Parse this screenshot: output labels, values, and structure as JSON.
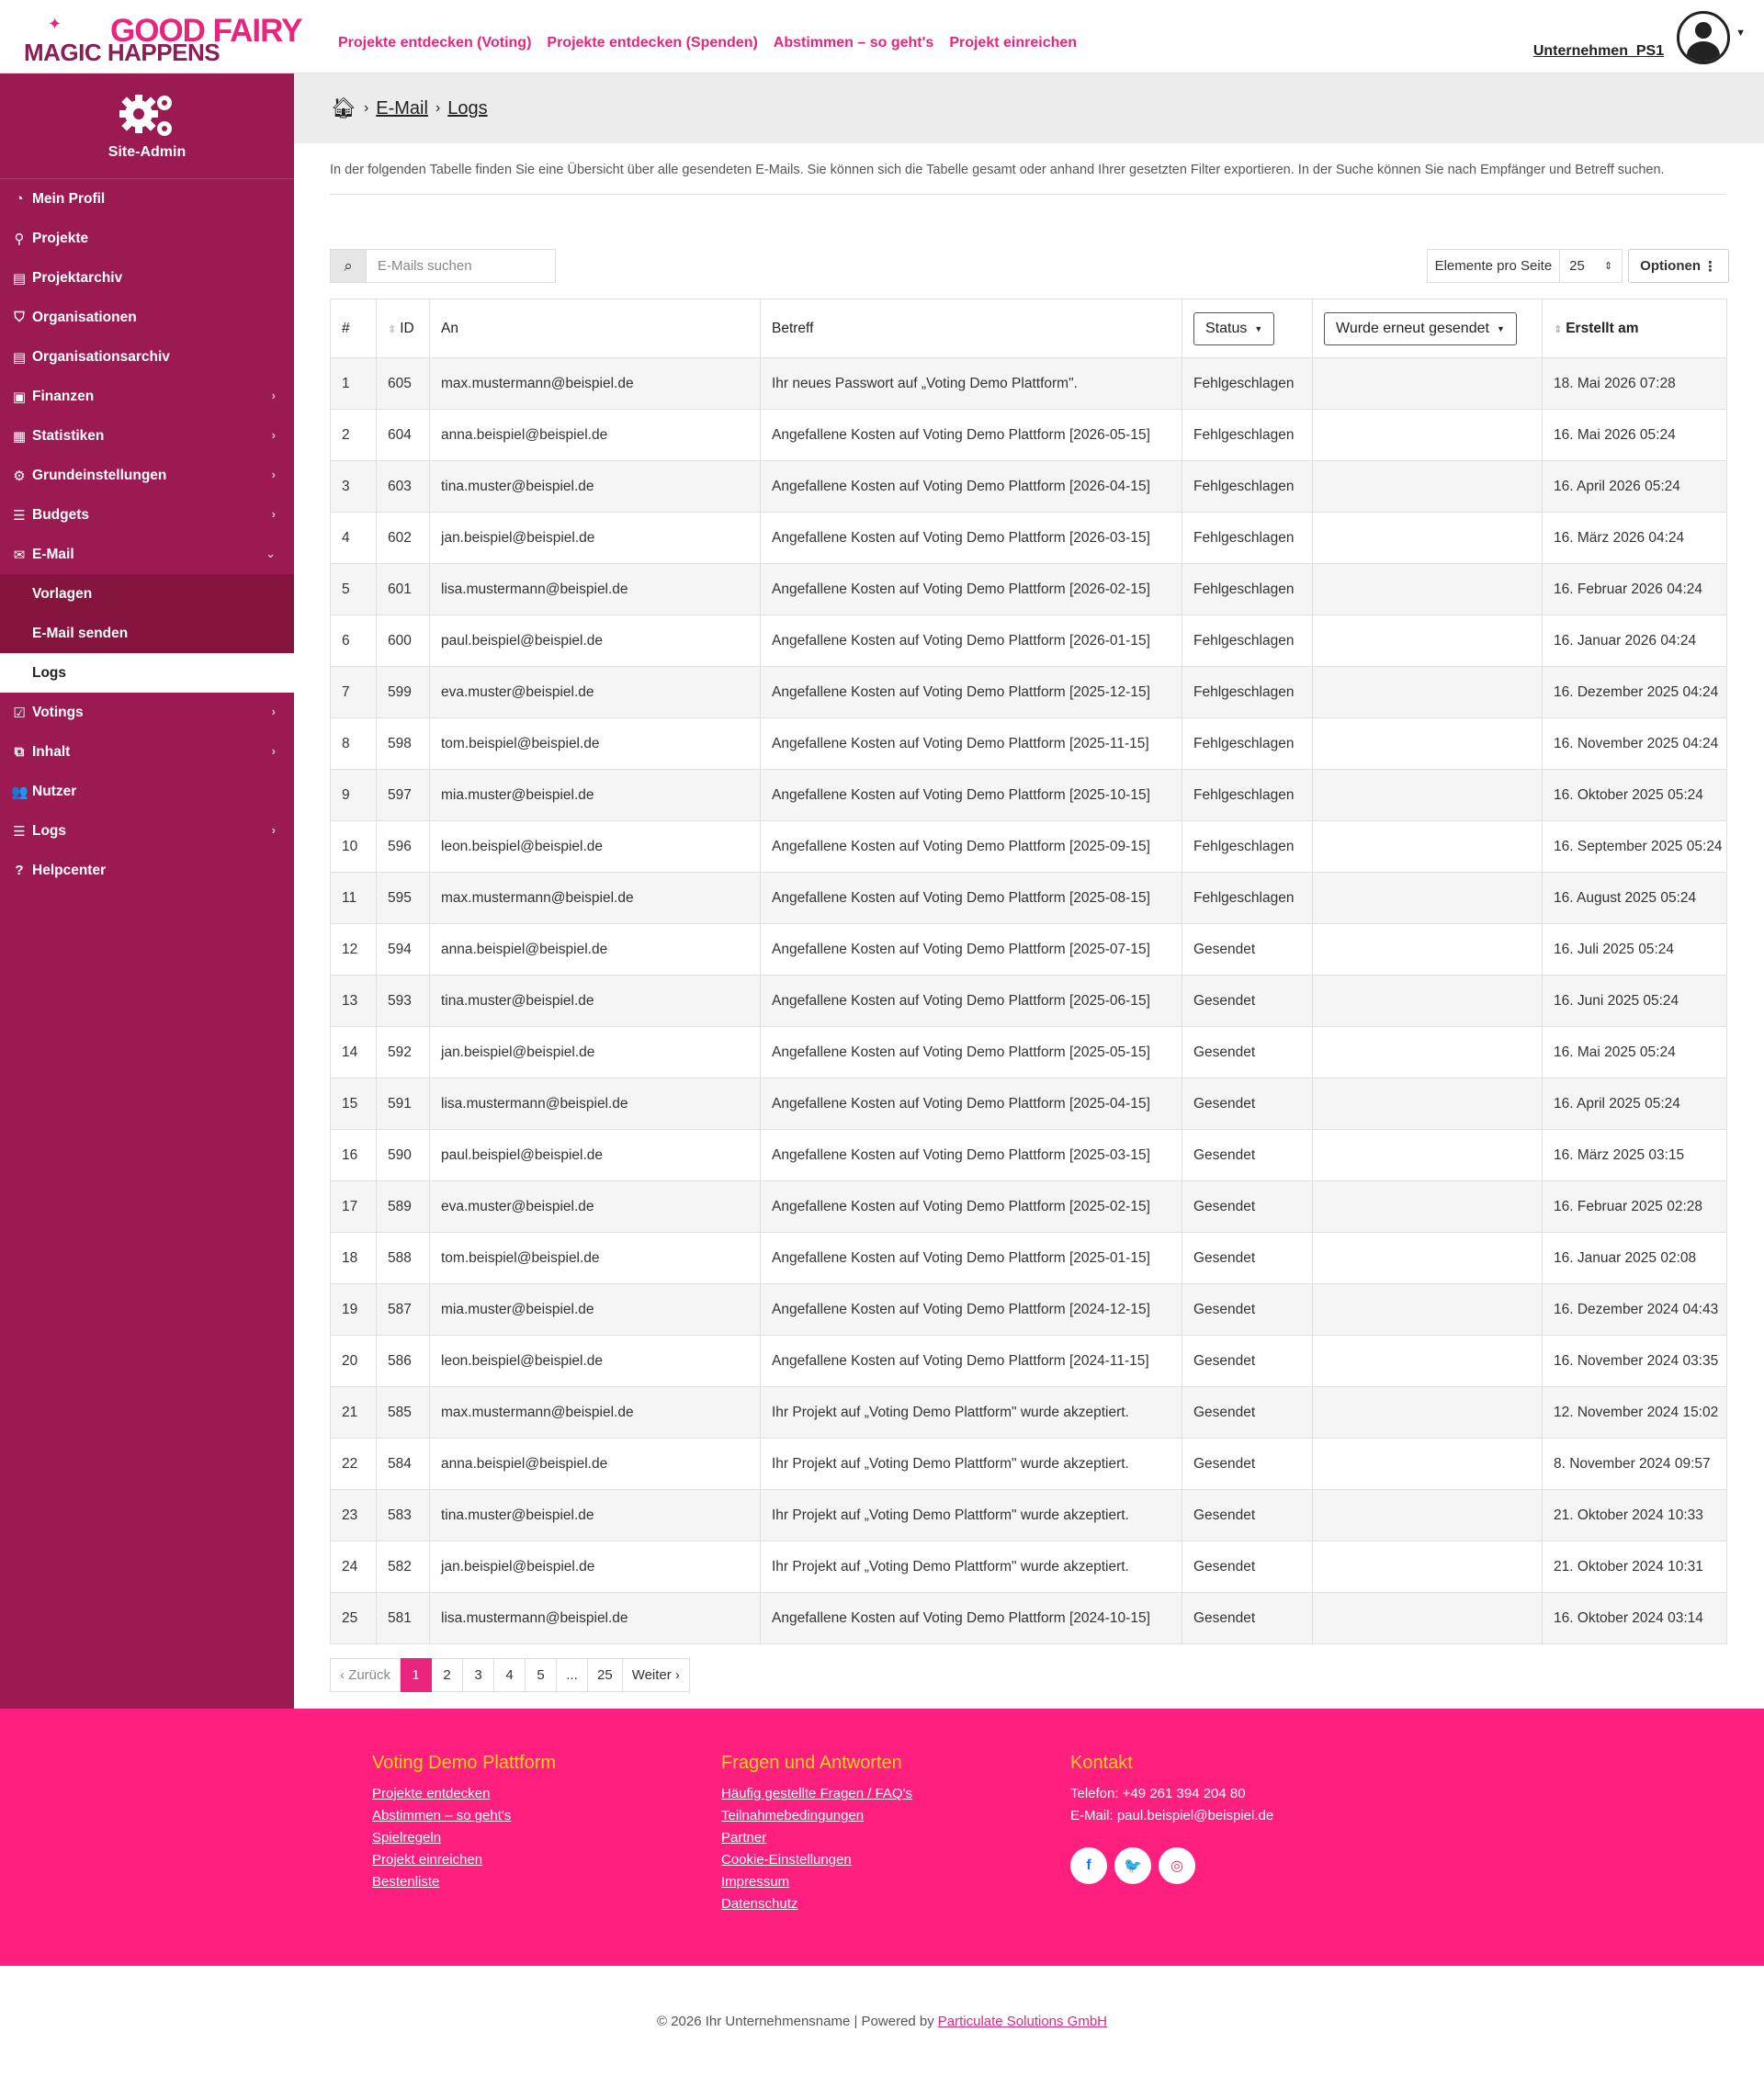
{
  "header": {
    "logo_top": "GOOD FAIRY",
    "logo_bottom": "MAGIC HAPPENS",
    "nav": [
      "Projekte entdecken (Voting)",
      "Projekte entdecken (Spenden)",
      "Abstimmen – so geht's",
      "Projekt einreichen"
    ],
    "username": "Unternehmen_PS1"
  },
  "sidebar": {
    "title": "Site-Admin",
    "items": [
      {
        "label": "Mein Profil",
        "icon": "dashboard-icon",
        "glyph": "◔"
      },
      {
        "label": "Projekte",
        "icon": "map-marker-icon",
        "glyph": "⚲"
      },
      {
        "label": "Projektarchiv",
        "icon": "archive-icon",
        "glyph": "▤"
      },
      {
        "label": "Organisationen",
        "icon": "shield-icon",
        "glyph": "⛉"
      },
      {
        "label": "Organisationsarchiv",
        "icon": "archive-icon",
        "glyph": "▤"
      },
      {
        "label": "Finanzen",
        "icon": "money-icon",
        "glyph": "▣"
      },
      {
        "label": "Statistiken",
        "icon": "bar-chart-icon",
        "glyph": "▦"
      },
      {
        "label": "Grundeinstellungen",
        "icon": "gears-icon",
        "glyph": "⚙"
      },
      {
        "label": "Budgets",
        "icon": "list-icon",
        "glyph": "☰"
      },
      {
        "label": "E-Mail",
        "icon": "envelope-icon",
        "glyph": "✉"
      }
    ],
    "email_sub": [
      "Vorlagen",
      "E-Mail senden",
      "Logs"
    ],
    "items_after": [
      {
        "label": "Votings",
        "icon": "checkbox-icon",
        "glyph": "☑"
      },
      {
        "label": "Inhalt",
        "icon": "sitemap-icon",
        "glyph": "⧉"
      },
      {
        "label": "Nutzer",
        "icon": "users-icon",
        "glyph": "👥"
      },
      {
        "label": "Logs",
        "icon": "list-icon",
        "glyph": "☰"
      },
      {
        "label": "Helpcenter",
        "icon": "question-circle-icon",
        "glyph": "?"
      }
    ]
  },
  "breadcrumb": {
    "level1": "E-Mail",
    "level2": "Logs"
  },
  "intro": "In der folgenden Tabelle finden Sie eine Übersicht über alle gesendeten E-Mails. Sie können sich die Tabelle gesamt oder anhand Ihrer gesetzten Filter exportieren. In der Suche können Sie nach Empfänger und Betreff suchen.",
  "search": {
    "placeholder": "E-Mails suchen"
  },
  "per_page": {
    "label": "Elemente pro Seite",
    "value": "25",
    "options_label": "Optionen"
  },
  "table": {
    "headers": {
      "num": "#",
      "id": "ID",
      "to": "An",
      "subject": "Betreff",
      "status": "Status",
      "resent": "Wurde erneut gesendet",
      "created": "Erstellt am"
    },
    "rows": [
      {
        "n": "1",
        "id": "605",
        "to": "max.mustermann@beispiel.de",
        "subject": "Ihr neues Passwort auf „Voting Demo Plattform\".",
        "status": "Fehlgeschlagen",
        "resent": "",
        "created": "18. Mai 2026 07:28"
      },
      {
        "n": "2",
        "id": "604",
        "to": "anna.beispiel@beispiel.de",
        "subject": "Angefallene Kosten auf Voting Demo Plattform [2026-05-15]",
        "status": "Fehlgeschlagen",
        "resent": "",
        "created": "16. Mai 2026 05:24"
      },
      {
        "n": "3",
        "id": "603",
        "to": "tina.muster@beispiel.de",
        "subject": "Angefallene Kosten auf Voting Demo Plattform [2026-04-15]",
        "status": "Fehlgeschlagen",
        "resent": "",
        "created": "16. April 2026 05:24"
      },
      {
        "n": "4",
        "id": "602",
        "to": "jan.beispiel@beispiel.de",
        "subject": "Angefallene Kosten auf Voting Demo Plattform [2026-03-15]",
        "status": "Fehlgeschlagen",
        "resent": "",
        "created": "16. März 2026 04:24"
      },
      {
        "n": "5",
        "id": "601",
        "to": "lisa.mustermann@beispiel.de",
        "subject": "Angefallene Kosten auf Voting Demo Plattform [2026-02-15]",
        "status": "Fehlgeschlagen",
        "resent": "",
        "created": "16. Februar 2026 04:24"
      },
      {
        "n": "6",
        "id": "600",
        "to": "paul.beispiel@beispiel.de",
        "subject": "Angefallene Kosten auf Voting Demo Plattform [2026-01-15]",
        "status": "Fehlgeschlagen",
        "resent": "",
        "created": "16. Januar 2026 04:24"
      },
      {
        "n": "7",
        "id": "599",
        "to": "eva.muster@beispiel.de",
        "subject": "Angefallene Kosten auf Voting Demo Plattform [2025-12-15]",
        "status": "Fehlgeschlagen",
        "resent": "",
        "created": "16. Dezember 2025 04:24"
      },
      {
        "n": "8",
        "id": "598",
        "to": "tom.beispiel@beispiel.de",
        "subject": "Angefallene Kosten auf Voting Demo Plattform [2025-11-15]",
        "status": "Fehlgeschlagen",
        "resent": "",
        "created": "16. November 2025 04:24"
      },
      {
        "n": "9",
        "id": "597",
        "to": "mia.muster@beispiel.de",
        "subject": "Angefallene Kosten auf Voting Demo Plattform [2025-10-15]",
        "status": "Fehlgeschlagen",
        "resent": "",
        "created": "16. Oktober 2025 05:24"
      },
      {
        "n": "10",
        "id": "596",
        "to": "leon.beispiel@beispiel.de",
        "subject": "Angefallene Kosten auf Voting Demo Plattform [2025-09-15]",
        "status": "Fehlgeschlagen",
        "resent": "",
        "created": "16. September 2025 05:24"
      },
      {
        "n": "11",
        "id": "595",
        "to": "max.mustermann@beispiel.de",
        "subject": "Angefallene Kosten auf Voting Demo Plattform [2025-08-15]",
        "status": "Fehlgeschlagen",
        "resent": "",
        "created": "16. August 2025 05:24"
      },
      {
        "n": "12",
        "id": "594",
        "to": "anna.beispiel@beispiel.de",
        "subject": "Angefallene Kosten auf Voting Demo Plattform [2025-07-15]",
        "status": "Gesendet",
        "resent": "",
        "created": "16. Juli 2025 05:24"
      },
      {
        "n": "13",
        "id": "593",
        "to": "tina.muster@beispiel.de",
        "subject": "Angefallene Kosten auf Voting Demo Plattform [2025-06-15]",
        "status": "Gesendet",
        "resent": "",
        "created": "16. Juni 2025 05:24"
      },
      {
        "n": "14",
        "id": "592",
        "to": "jan.beispiel@beispiel.de",
        "subject": "Angefallene Kosten auf Voting Demo Plattform [2025-05-15]",
        "status": "Gesendet",
        "resent": "",
        "created": "16. Mai 2025 05:24"
      },
      {
        "n": "15",
        "id": "591",
        "to": "lisa.mustermann@beispiel.de",
        "subject": "Angefallene Kosten auf Voting Demo Plattform [2025-04-15]",
        "status": "Gesendet",
        "resent": "",
        "created": "16. April 2025 05:24"
      },
      {
        "n": "16",
        "id": "590",
        "to": "paul.beispiel@beispiel.de",
        "subject": "Angefallene Kosten auf Voting Demo Plattform [2025-03-15]",
        "status": "Gesendet",
        "resent": "",
        "created": "16. März 2025 03:15"
      },
      {
        "n": "17",
        "id": "589",
        "to": "eva.muster@beispiel.de",
        "subject": "Angefallene Kosten auf Voting Demo Plattform [2025-02-15]",
        "status": "Gesendet",
        "resent": "",
        "created": "16. Februar 2025 02:28"
      },
      {
        "n": "18",
        "id": "588",
        "to": "tom.beispiel@beispiel.de",
        "subject": "Angefallene Kosten auf Voting Demo Plattform [2025-01-15]",
        "status": "Gesendet",
        "resent": "",
        "created": "16. Januar 2025 02:08"
      },
      {
        "n": "19",
        "id": "587",
        "to": "mia.muster@beispiel.de",
        "subject": "Angefallene Kosten auf Voting Demo Plattform [2024-12-15]",
        "status": "Gesendet",
        "resent": "",
        "created": "16. Dezember 2024 04:43"
      },
      {
        "n": "20",
        "id": "586",
        "to": "leon.beispiel@beispiel.de",
        "subject": "Angefallene Kosten auf Voting Demo Plattform [2024-11-15]",
        "status": "Gesendet",
        "resent": "",
        "created": "16. November 2024 03:35"
      },
      {
        "n": "21",
        "id": "585",
        "to": "max.mustermann@beispiel.de",
        "subject": "Ihr Projekt auf „Voting Demo Plattform\" wurde akzeptiert.",
        "status": "Gesendet",
        "resent": "",
        "created": "12. November 2024 15:02"
      },
      {
        "n": "22",
        "id": "584",
        "to": "anna.beispiel@beispiel.de",
        "subject": "Ihr Projekt auf „Voting Demo Plattform\" wurde akzeptiert.",
        "status": "Gesendet",
        "resent": "",
        "created": "8. November 2024 09:57"
      },
      {
        "n": "23",
        "id": "583",
        "to": "tina.muster@beispiel.de",
        "subject": "Ihr Projekt auf „Voting Demo Plattform\" wurde akzeptiert.",
        "status": "Gesendet",
        "resent": "",
        "created": "21. Oktober 2024 10:33"
      },
      {
        "n": "24",
        "id": "582",
        "to": "jan.beispiel@beispiel.de",
        "subject": "Ihr Projekt auf „Voting Demo Plattform\" wurde akzeptiert.",
        "status": "Gesendet",
        "resent": "",
        "created": "21. Oktober 2024 10:31"
      },
      {
        "n": "25",
        "id": "581",
        "to": "lisa.mustermann@beispiel.de",
        "subject": "Angefallene Kosten auf Voting Demo Plattform [2024-10-15]",
        "status": "Gesendet",
        "resent": "",
        "created": "16. Oktober 2024 03:14"
      }
    ]
  },
  "pagination": {
    "prev": "‹ Zurück",
    "pages": [
      "1",
      "2",
      "3",
      "4",
      "5",
      "...",
      "25"
    ],
    "active": "1",
    "next": "Weiter ›"
  },
  "footer": {
    "col1": {
      "title": "Voting Demo Plattform",
      "links": [
        "Projekte entdecken",
        "Abstimmen – so geht's",
        "Spielregeln",
        "Projekt einreichen",
        "Bestenliste"
      ]
    },
    "col2": {
      "title": "Fragen und Antworten",
      "links": [
        "Häufig gestellte Fragen / FAQ's",
        "Teilnahmebedingungen",
        "Partner",
        "Cookie-Einstellungen",
        "Impressum",
        "Datenschutz"
      ]
    },
    "col3": {
      "title": "Kontakt",
      "phone": "Telefon: +49 261 394 204 80",
      "email": "E-Mail: paul.beispiel@beispiel.de"
    },
    "social": [
      {
        "icon": "facebook-icon",
        "glyph": "f",
        "color": "#1877f2"
      },
      {
        "icon": "twitter-icon",
        "glyph": "🐦",
        "color": "#1da1f2"
      },
      {
        "icon": "instagram-icon",
        "glyph": "◎",
        "color": "#e1306c"
      }
    ],
    "copyright": "© 2026 Ihr Unternehmensname | Powered by",
    "powered_link": "Particulate Solutions GmbH"
  },
  "colors": {
    "brand_pink": "#e8247c",
    "sidebar": "#9c1a52",
    "footer": "#ff1f7e",
    "footer_heading": "#ffd21f"
  }
}
